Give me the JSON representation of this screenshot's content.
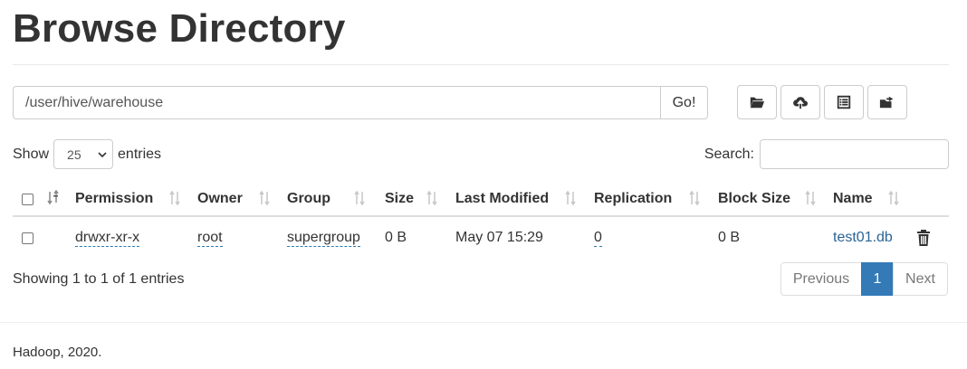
{
  "page": {
    "title": "Browse Directory"
  },
  "path": {
    "value": "/user/hive/warehouse",
    "go_label": "Go!"
  },
  "toolbar": {
    "buttons": [
      {
        "icon": "folder-open-icon"
      },
      {
        "icon": "cloud-upload-icon"
      },
      {
        "icon": "list-alt-icon"
      },
      {
        "icon": "folder-move-icon"
      }
    ]
  },
  "length": {
    "show_label": "Show",
    "selected": "25",
    "entries_label": "entries"
  },
  "search": {
    "label": "Search:",
    "value": ""
  },
  "table": {
    "columns": [
      "Permission",
      "Owner",
      "Group",
      "Size",
      "Last Modified",
      "Replication",
      "Block Size",
      "Name"
    ],
    "rows": [
      {
        "permission": "drwxr-xr-x",
        "owner": "root",
        "group": "supergroup",
        "size": "0 B",
        "last_modified": "May 07 15:29",
        "replication": "0",
        "block_size": "0 B",
        "name": "test01.db"
      }
    ]
  },
  "info": "Showing 1 to 1 of 1 entries",
  "pagination": {
    "previous": "Previous",
    "current": "1",
    "next": "Next"
  },
  "footer": "Hadoop, 2020.",
  "colors": {
    "accent": "#337ab7",
    "link": "#2a6496"
  }
}
